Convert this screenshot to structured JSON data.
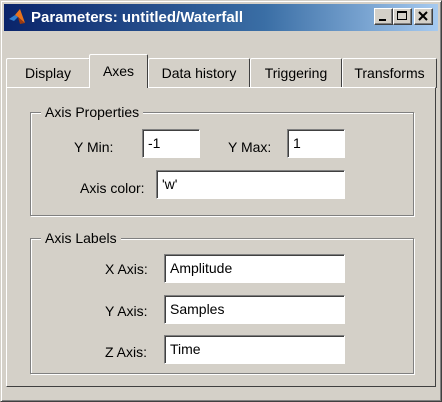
{
  "window": {
    "title": "Parameters: untitled/Waterfall",
    "app_icon": "matlab-icon",
    "controls": {
      "minimize_icon": "minimize-icon",
      "maximize_icon": "maximize-icon",
      "close_icon": "close-icon"
    }
  },
  "tabs": [
    {
      "label": "Display",
      "active": false
    },
    {
      "label": "Axes",
      "active": true
    },
    {
      "label": "Data history",
      "active": false
    },
    {
      "label": "Triggering",
      "active": false
    },
    {
      "label": "Transforms",
      "active": false
    }
  ],
  "axis_properties": {
    "legend": "Axis Properties",
    "y_min": {
      "label": "Y Min:",
      "value": "-1"
    },
    "y_max": {
      "label": "Y Max:",
      "value": "1"
    },
    "axis_color": {
      "label": "Axis color:",
      "value": "'w'"
    }
  },
  "axis_labels": {
    "legend": "Axis Labels",
    "x_axis": {
      "label": "X Axis:",
      "value": "Amplitude"
    },
    "y_axis": {
      "label": "Y Axis:",
      "value": "Samples"
    },
    "z_axis": {
      "label": "Z Axis:",
      "value": "Time"
    }
  },
  "colors": {
    "dialog_face": "#d4d0c8",
    "titlebar_start": "#0a246a",
    "titlebar_end": "#a6caf0",
    "field_bg": "#ffffff"
  }
}
